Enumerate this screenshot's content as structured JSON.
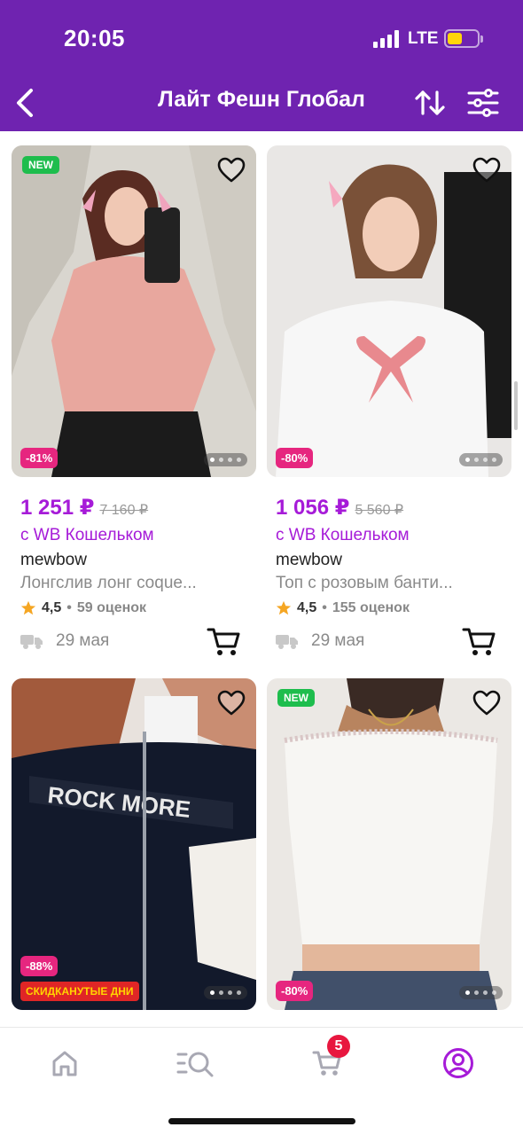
{
  "status_bar": {
    "time": "20:05",
    "network": "LTE"
  },
  "nav": {
    "title": "Лайт Фешн Глобал"
  },
  "products": [
    {
      "badge_new": "NEW",
      "discount": "-81%",
      "price": "1 251 ₽",
      "old_price": "7 160 ₽",
      "wallet_text": "с WB Кошельком",
      "brand": "mewbow",
      "title": "Лонгслив лонг coque...",
      "rating": "4,5",
      "reviews": "59 оценок",
      "delivery": "29 мая"
    },
    {
      "discount": "-80%",
      "price": "1 056 ₽",
      "old_price": "5 560 ₽",
      "wallet_text": "с WB Кошельком",
      "brand": "mewbow",
      "title": "Топ с розовым банти...",
      "rating": "4,5",
      "reviews": "155 оценок",
      "delivery": "29 мая"
    },
    {
      "discount": "-88%",
      "promo": "СКИДКАНУТЫЕ ДНИ"
    },
    {
      "badge_new": "NEW",
      "discount": "-80%"
    }
  ],
  "tabbar": {
    "cart_count": "5"
  },
  "colors": {
    "header": "#6f23b0",
    "accent": "#a61bd8",
    "discount": "#e6267f",
    "new_badge": "#1ebd4d"
  },
  "icons": [
    "back-arrow-icon",
    "sort-icon",
    "filter-icon",
    "heart-icon",
    "star-icon",
    "truck-icon",
    "cart-icon",
    "home-icon",
    "catalog-search-icon",
    "profile-icon"
  ]
}
